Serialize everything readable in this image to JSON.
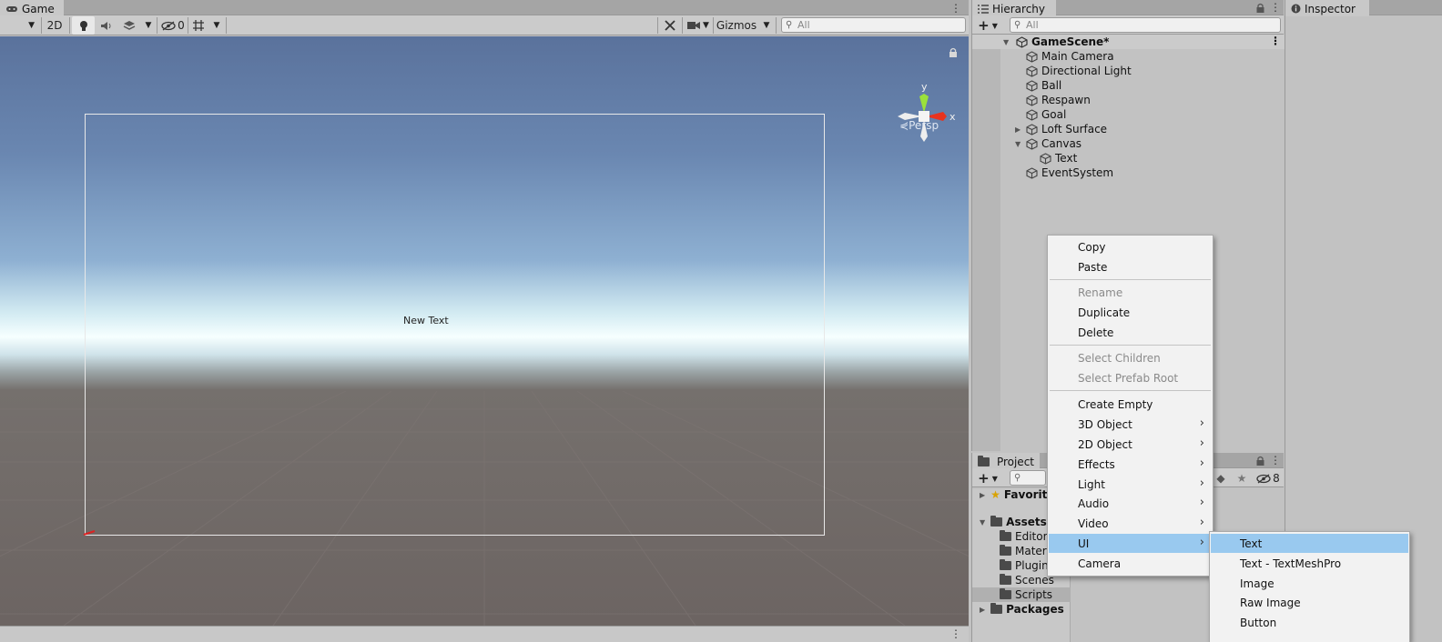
{
  "game": {
    "tab_title": "Game",
    "toolbar": {
      "mode_2d": "2D",
      "hidden_count": "0",
      "gizmos_label": "Gizmos",
      "search_placeholder": "All"
    },
    "viewport": {
      "canvas_text": "New Text",
      "gizmo_y_label": "y",
      "gizmo_x_label": "x",
      "persp_label": "Persp",
      "sky_top_color": "#5a729c",
      "horizon_color": "#f6ffff",
      "ground_color": "#6c6462"
    }
  },
  "hierarchy": {
    "tab_title": "Hierarchy",
    "search_placeholder": "All",
    "scene_name": "GameScene*",
    "items": [
      {
        "label": "Main Camera"
      },
      {
        "label": "Directional Light"
      },
      {
        "label": "Ball"
      },
      {
        "label": "Respawn"
      },
      {
        "label": "Goal"
      },
      {
        "label": "Loft Surface"
      },
      {
        "label": "Canvas"
      },
      {
        "label": "Text"
      },
      {
        "label": "EventSystem"
      }
    ]
  },
  "inspector": {
    "tab_title": "Inspector"
  },
  "project": {
    "tab_title": "Project",
    "hidden_count": "8",
    "favorites_label": "Favorite",
    "assets_label": "Assets",
    "folders": [
      {
        "label": "Editor"
      },
      {
        "label": "Materi"
      },
      {
        "label": "Plugin"
      },
      {
        "label": "Scenes"
      },
      {
        "label": "Scripts"
      }
    ],
    "packages_label": "Packages"
  },
  "context_menu": {
    "items": [
      {
        "label": "Copy"
      },
      {
        "label": "Paste"
      },
      {
        "label": "Rename"
      },
      {
        "label": "Duplicate"
      },
      {
        "label": "Delete"
      },
      {
        "label": "Select Children"
      },
      {
        "label": "Select Prefab Root"
      },
      {
        "label": "Create Empty"
      },
      {
        "label": "3D Object"
      },
      {
        "label": "2D Object"
      },
      {
        "label": "Effects"
      },
      {
        "label": "Light"
      },
      {
        "label": "Audio"
      },
      {
        "label": "Video"
      },
      {
        "label": "UI"
      },
      {
        "label": "Camera"
      }
    ],
    "submenu_arrow": "›",
    "highlight_color": "#99c9ef"
  },
  "ui_submenu": {
    "items": [
      {
        "label": "Text"
      },
      {
        "label": "Text - TextMeshPro"
      },
      {
        "label": "Image"
      },
      {
        "label": "Raw Image"
      },
      {
        "label": "Button"
      }
    ]
  }
}
